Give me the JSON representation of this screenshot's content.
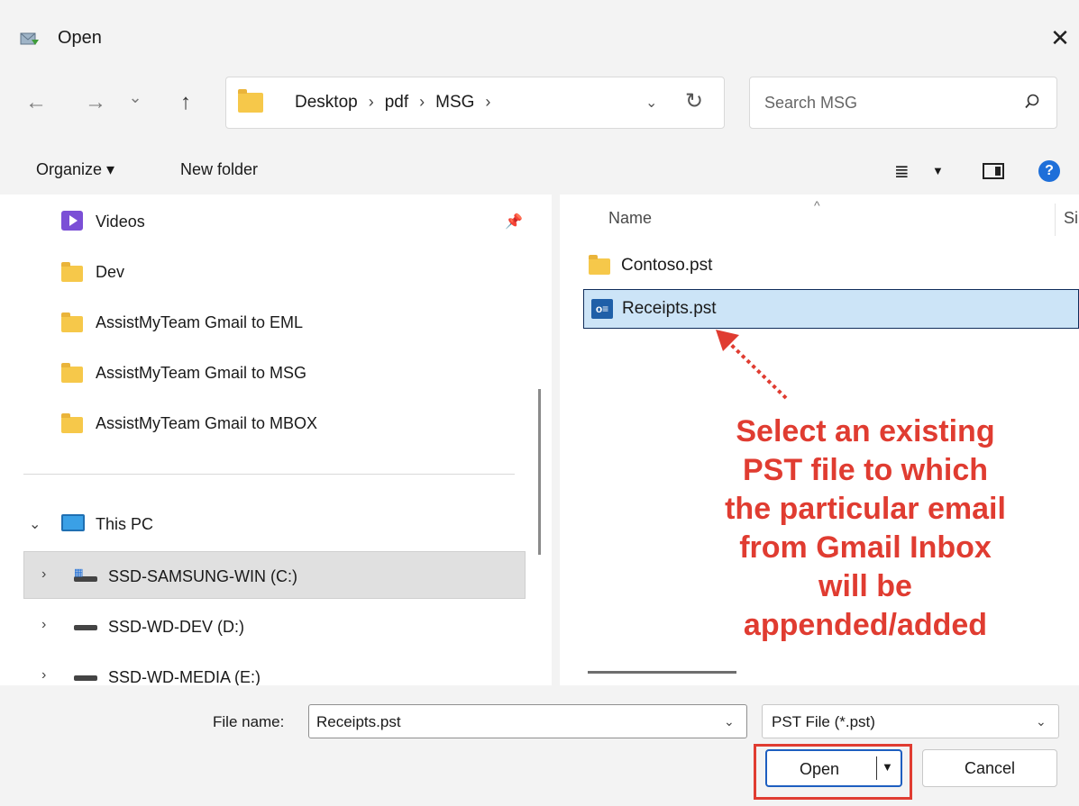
{
  "window": {
    "title": "Open"
  },
  "nav": {
    "back": "←",
    "forward": "→",
    "recent": "⌄",
    "up": "↑",
    "breadcrumb_overflow": "«",
    "breadcrumbs": [
      "Desktop",
      "pdf",
      "MSG"
    ],
    "address_dropdown": "⌄",
    "refresh": "↻"
  },
  "search": {
    "placeholder": "Search MSG"
  },
  "toolbar": {
    "organize_label": "Organize ▾",
    "new_folder_label": "New folder",
    "help_label": "?"
  },
  "sidebar": {
    "quick_access": [
      {
        "label": "Videos",
        "icon": "videos-icon"
      },
      {
        "label": "Dev",
        "icon": "folder-icon"
      },
      {
        "label": "AssistMyTeam Gmail to EML",
        "icon": "folder-icon"
      },
      {
        "label": "AssistMyTeam Gmail to MSG",
        "icon": "folder-icon"
      },
      {
        "label": "AssistMyTeam Gmail to MBOX",
        "icon": "folder-icon"
      }
    ],
    "this_pc": "This PC",
    "drives": [
      {
        "label": "SSD-SAMSUNG-WIN (C:)",
        "selected": true
      },
      {
        "label": "SSD-WD-DEV (D:)",
        "selected": false
      },
      {
        "label": "SSD-WD-MEDIA (E:)",
        "selected": false
      }
    ]
  },
  "files": {
    "columns": [
      "Name",
      "Si"
    ],
    "rows": [
      {
        "name": "Contoso.pst",
        "icon": "folder-icon",
        "selected": false
      },
      {
        "name": "Receipts.pst",
        "icon": "outlook-data-file-icon",
        "selected": true
      }
    ]
  },
  "annotation": {
    "lines": [
      "Select an existing",
      "PST file to which",
      "the particular email",
      "from Gmail Inbox",
      "will be",
      "appended/added"
    ],
    "color": "#e03c31"
  },
  "footer": {
    "file_name_label": "File name:",
    "file_name_value": "Receipts.pst",
    "file_type_value": "PST File (*.pst)",
    "open_label": "Open",
    "cancel_label": "Cancel"
  },
  "colors": {
    "accent": "#1d5ec0",
    "selection": "#cce4f7",
    "highlight": "#e03c31"
  }
}
